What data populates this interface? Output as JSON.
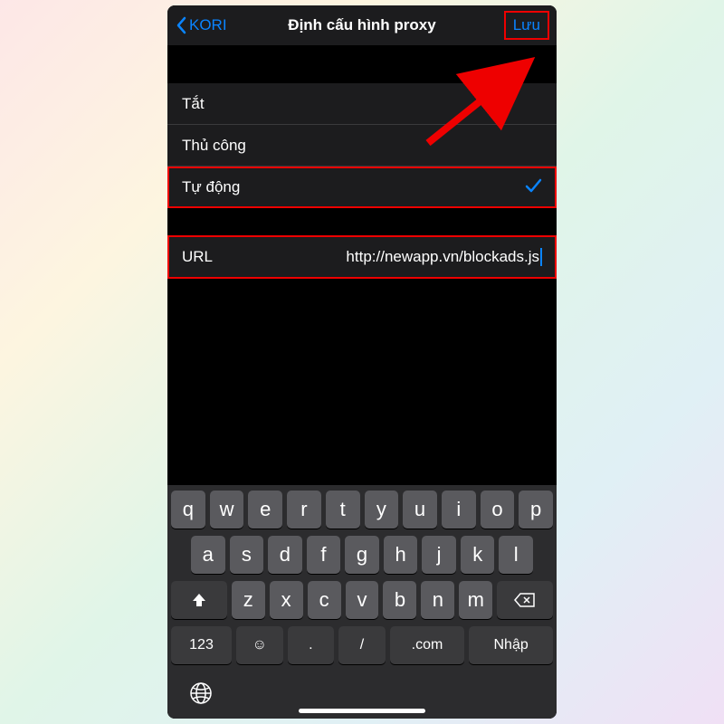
{
  "nav": {
    "back_label": "KORI",
    "title": "Định cấu hình proxy",
    "save_label": "Lưu"
  },
  "options": {
    "off": "Tắt",
    "manual": "Thủ công",
    "auto": "Tự động"
  },
  "url": {
    "label": "URL",
    "value": "http://newapp.vn/blockads.js"
  },
  "keyboard": {
    "row1": [
      "q",
      "w",
      "e",
      "r",
      "t",
      "y",
      "u",
      "i",
      "o",
      "p"
    ],
    "row2": [
      "a",
      "s",
      "d",
      "f",
      "g",
      "h",
      "j",
      "k",
      "l"
    ],
    "row3": [
      "z",
      "x",
      "c",
      "v",
      "b",
      "n",
      "m"
    ],
    "numKey": "123",
    "dot": ".",
    "slash": "/",
    "com": ".com",
    "enter": "Nhập"
  }
}
